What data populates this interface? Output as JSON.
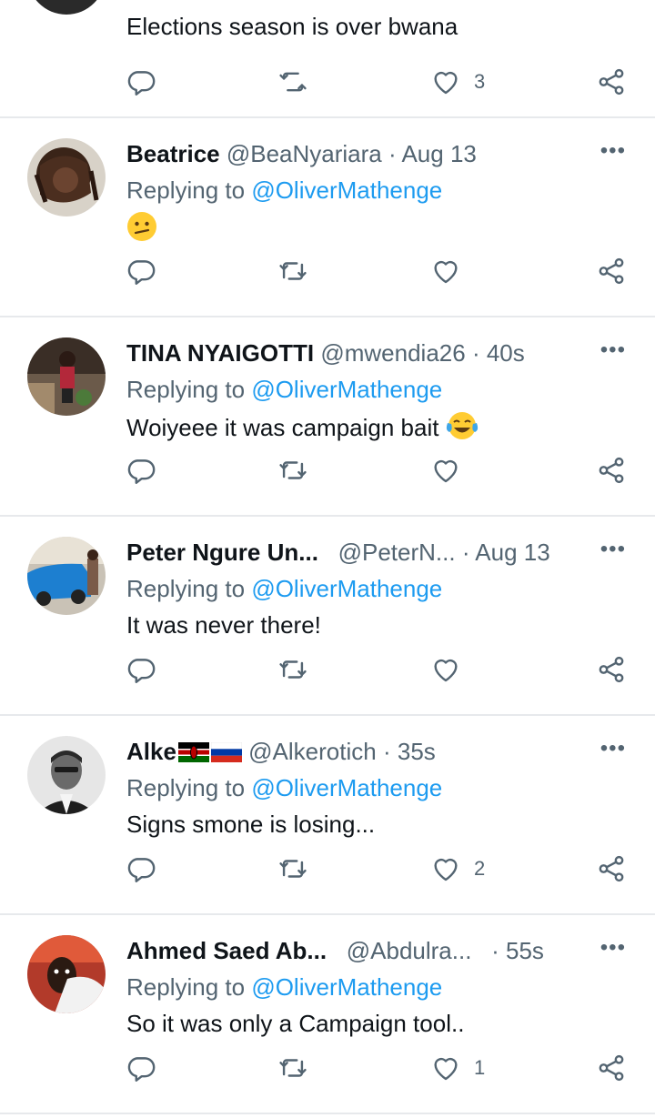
{
  "feed": {
    "tweets": [
      {
        "text": "Elections season is over bwana",
        "likes": "3"
      },
      {
        "name": "Beatrice",
        "handle": "@BeaNyariara",
        "sep": "·",
        "time": "Aug 13",
        "replying_prefix": "Replying to ",
        "replying_to": "@OliverMathenge",
        "text": "",
        "emoji": "confused-face-emoji",
        "likes": ""
      },
      {
        "name": "TINA NYAIGOTTI",
        "handle": "@mwendia26",
        "sep": "·",
        "time": "40s",
        "replying_prefix": "Replying to ",
        "replying_to": "@OliverMathenge",
        "text": "Woiyeee it was campaign bait ",
        "emoji": "tears-of-joy-emoji",
        "likes": ""
      },
      {
        "name": "Peter Ngure Un...",
        "handle": "@PeterN...",
        "sep": "·",
        "time": "Aug 13",
        "replying_prefix": "Replying to ",
        "replying_to": "@OliverMathenge",
        "text": "It was never there!",
        "likes": ""
      },
      {
        "name": "Alke",
        "flags": [
          "kenya-flag",
          "russia-flag"
        ],
        "handle": "@Alkerotich",
        "sep": "·",
        "time": "35s",
        "replying_prefix": "Replying to ",
        "replying_to": "@OliverMathenge",
        "text": "Signs smone is losing...",
        "likes": "2"
      },
      {
        "name": "Ahmed Saed Ab...",
        "handle": "@Abdulra...",
        "sep": "·",
        "time": "55s",
        "replying_prefix": "Replying to ",
        "replying_to": "@OliverMathenge",
        "text": "So it was only a Campaign tool..",
        "likes": "1"
      }
    ],
    "more_label": "•••"
  },
  "colors": {
    "text": "#0f1419",
    "secondary": "#536471",
    "link": "#1d9bf0",
    "divider": "#e7e9ec"
  }
}
